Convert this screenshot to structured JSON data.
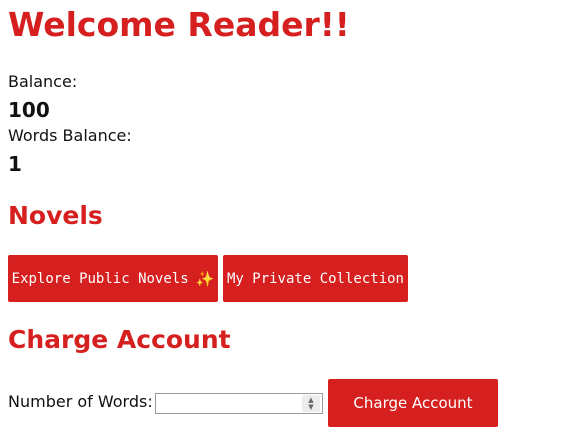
{
  "header": {
    "welcome_title": "Welcome Reader!!"
  },
  "account": {
    "balance_label": "Balance:",
    "balance_value": "100",
    "words_balance_label": "Words Balance:",
    "words_balance_value": "1"
  },
  "novels": {
    "heading": "Novels",
    "explore_button_label": "Explore Public Novels",
    "explore_button_icon": "sparkles-icon",
    "private_button_label": "My Private Collection"
  },
  "charge": {
    "heading": "Charge Account",
    "words_label": "Number of Words:",
    "words_value": "",
    "submit_label": "Charge Account"
  },
  "colors": {
    "accent": "#d61f1f",
    "button_text": "#ffffff",
    "body_text": "#111111"
  }
}
